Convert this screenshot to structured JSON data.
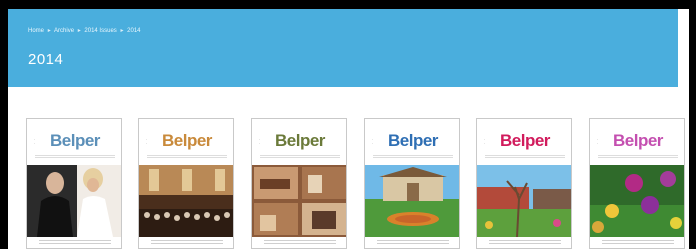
{
  "breadcrumb": {
    "items": [
      "Home",
      "Archive",
      "2014 Issues",
      "2014"
    ]
  },
  "page_title": "2014",
  "covers": [
    {
      "brand": "Belper",
      "brand_color": "#5b8fb8"
    },
    {
      "brand": "Belper",
      "brand_color": "#c98a3b"
    },
    {
      "brand": "Belper",
      "brand_color": "#6b7a3a"
    },
    {
      "brand": "Belper",
      "brand_color": "#2f6fb4"
    },
    {
      "brand": "Belper",
      "brand_color": "#d11b5c"
    },
    {
      "brand": "Belper",
      "brand_color": "#c44fb0"
    }
  ],
  "colors": {
    "header_bg": "#4aaedd",
    "frame_bg": "#000000"
  }
}
